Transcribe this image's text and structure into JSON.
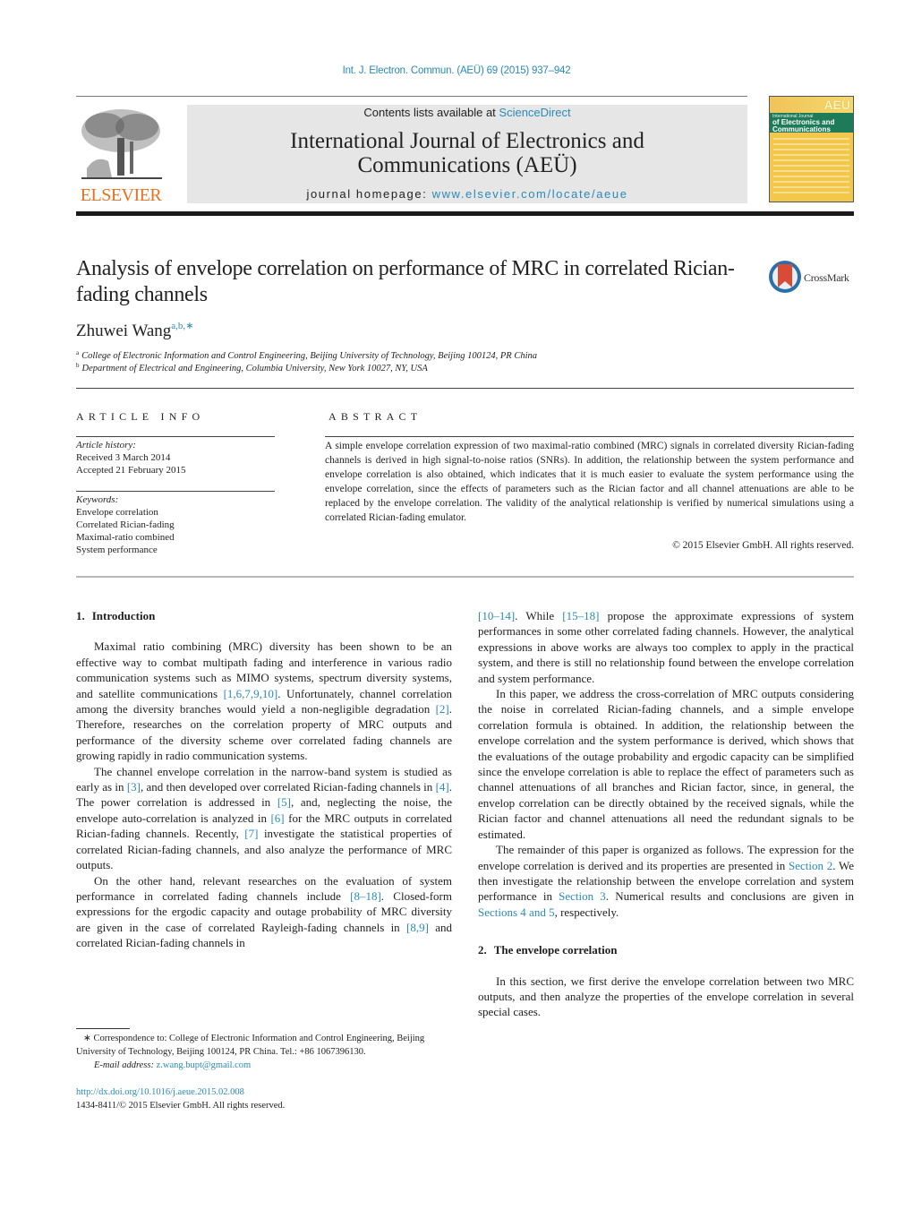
{
  "header": {
    "journal_reference": "Int. J. Electron. Commun. (AEÜ) 69 (2015) 937–942",
    "contents_prefix": "Contents lists available at ",
    "contents_link": "ScienceDirect",
    "journal_title_line1": "International Journal of Electronics and",
    "journal_title_line2": "Communications (AEÜ)",
    "homepage_prefix": "journal homepage: ",
    "homepage_link": "www.elsevier.com/locate/aeue",
    "publisher_logo_text": "ELSEVIER",
    "cover": {
      "badge": "AEÜ",
      "small": "International Journal",
      "title_line1": "of Electronics and",
      "title_line2": "Communications"
    },
    "colors": {
      "link": "#2a8ab8",
      "elsevier_orange": "#e9711c",
      "banner_gray": "#e6e6e6",
      "cover_green": "#1e7b5a",
      "cover_yellow": "#f3c84a"
    }
  },
  "article": {
    "title": "Analysis of envelope correlation on performance of MRC in correlated Rician-fading channels",
    "crossmark_label": "CrossMark",
    "author": "Zhuwei Wang",
    "author_marks": "a,b,",
    "author_star": "∗",
    "affiliations": [
      {
        "mark": "a",
        "text": "College of Electronic Information and Control Engineering, Beijing University of Technology, Beijing 100124, PR China"
      },
      {
        "mark": "b",
        "text": "Department of Electrical and Engineering, Columbia University, New York 10027, NY, USA"
      }
    ]
  },
  "article_info": {
    "heading": "ARTICLE INFO",
    "history_label": "Article history:",
    "received": "Received 3 March 2014",
    "accepted": "Accepted 21 February 2015",
    "keywords_label": "Keywords:",
    "keywords": [
      "Envelope correlation",
      "Correlated Rician-fading",
      "Maximal-ratio combined",
      "System performance"
    ]
  },
  "abstract": {
    "heading": "ABSTRACT",
    "text": "A simple envelope correlation expression of two maximal-ratio combined (MRC) signals in correlated diversity Rician-fading channels is derived in high signal-to-noise ratios (SNRs). In addition, the relationship between the system performance and envelope correlation is also obtained, which indicates that it is much easier to evaluate the system performance using the envelope correlation, since the effects of parameters such as the Rician factor and all channel attenuations are able to be replaced by the envelope correlation. The validity of the analytical relationship is verified by numerical simulations using a correlated Rician-fading emulator.",
    "copyright": "© 2015 Elsevier GmbH. All rights reserved."
  },
  "body": {
    "section1": {
      "number": "1.",
      "title": "Introduction",
      "p1": {
        "t1": "Maximal ratio combining (MRC) diversity has been shown to be an effective way to combat multipath fading and interference in various radio communication systems such as MIMO systems, spectrum diversity systems, and satellite communications ",
        "r1": "[1,6,7,9,10]",
        "t2": ". Unfortunately, channel correlation among the diversity branches would yield a non-negligible degradation ",
        "r2": "[2]",
        "t3": ". Therefore, researches on the correlation property of MRC outputs and performance of the diversity scheme over correlated fading channels are growing rapidly in radio communication systems."
      },
      "p2": {
        "t1": "The channel envelope correlation in the narrow-band system is studied as early as in ",
        "r1": "[3]",
        "t2": ", and then developed over correlated Rician-fading channels in ",
        "r2": "[4]",
        "t3": ". The power correlation is addressed in ",
        "r3": "[5]",
        "t4": ", and, neglecting the noise, the envelope auto-correlation is analyzed in ",
        "r4": "[6]",
        "t5": " for the MRC outputs in correlated Rician-fading channels. Recently, ",
        "r5": "[7]",
        "t6": " investigate the statistical properties of correlated Rician-fading channels, and also analyze the performance of MRC outputs."
      },
      "p3": {
        "t1": "On the other hand, relevant researches on the evaluation of system performance in correlated fading channels include ",
        "r1": "[8–18]",
        "t2": ". Closed-form expressions for the ergodic capacity and outage probability of MRC diversity are given in the case of correlated Rayleigh-fading channels in ",
        "r2": "[8,9]",
        "t3": " and correlated Rician-fading channels in ",
        "r3": "[10–14]",
        "t4": ". While ",
        "r4": "[15–18]",
        "t5": " propose the approximate expressions of system performances in some other correlated fading channels. However, the analytical expressions in above works are always too complex to apply in the practical system, and there is still no relationship found between the envelope correlation and system performance."
      },
      "p4": "In this paper, we address the cross-correlation of MRC outputs considering the noise in correlated Rician-fading channels, and a simple envelope correlation formula is obtained. In addition, the relationship between the envelope correlation and the system performance is derived, which shows that the evaluations of the outage probability and ergodic capacity can be simplified since the envelope correlation is able to replace the effect of parameters such as channel attenuations of all branches and Rician factor, since, in general, the envelop correlation can be directly obtained by the received signals, while the Rician factor and channel attenuations all need the redundant signals to be estimated.",
      "p5": {
        "t1": "The remainder of this paper is organized as follows. The expression for the envelope correlation is derived and its properties are presented in ",
        "r1": "Section 2",
        "t2": ". We then investigate the relationship between the envelope correlation and system performance in ",
        "r2": "Section 3",
        "t3": ". Numerical results and conclusions are given in ",
        "r3": "Sections 4 and 5",
        "t4": ", respectively."
      }
    },
    "section2": {
      "number": "2.",
      "title": "The envelope correlation",
      "p1": "In this section, we first derive the envelope correlation between two MRC outputs, and then analyze the properties of the envelope correlation in several special cases."
    }
  },
  "footnote": {
    "star": "∗",
    "correspondence": " Correspondence to: College of Electronic Information and Control Engineering, Beijing University of Technology, Beijing 100124, PR China. Tel.: +86 1067396130.",
    "email_label": "E-mail address:",
    "email": "z.wang.bupt@gmail.com",
    "doi": "http://dx.doi.org/10.1016/j.aeue.2015.02.008",
    "issn_copyright": "1434-8411/© 2015 Elsevier GmbH. All rights reserved."
  }
}
